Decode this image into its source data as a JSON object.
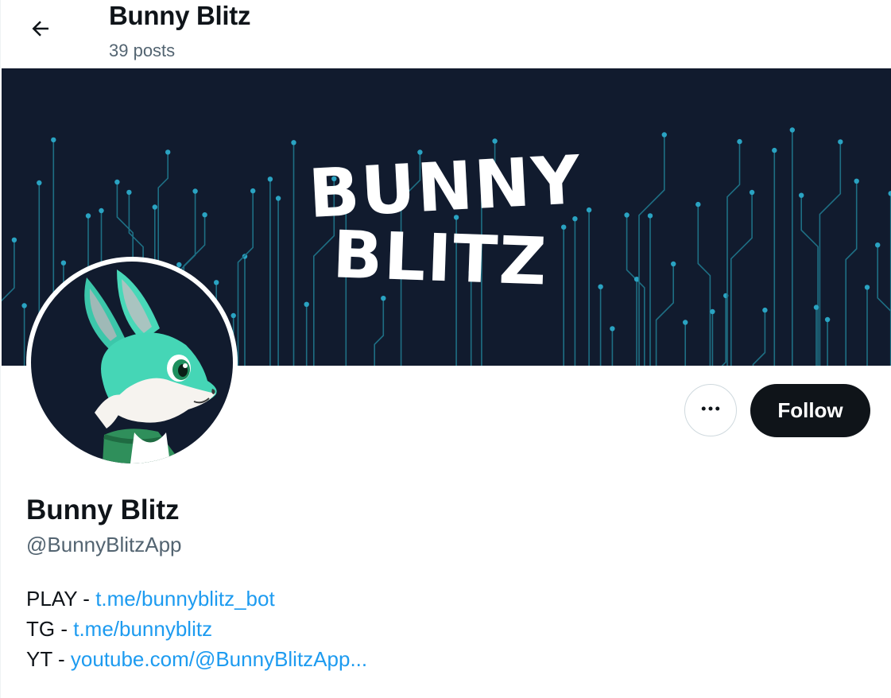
{
  "header": {
    "title": "Bunny Blitz",
    "post_count": "39 posts",
    "back_icon": "arrow-left-icon"
  },
  "banner": {
    "line1": "BUNNY",
    "line2": "BLITZ",
    "colors": {
      "background": "#111b2e",
      "circuit": "#1e6f84",
      "node": "#2aa3c2"
    }
  },
  "profile": {
    "display_name": "Bunny Blitz",
    "handle": "@BunnyBlitzApp",
    "avatar_icon": "bunny-avatar-icon"
  },
  "actions": {
    "more_icon": "more-horizontal-icon",
    "follow_label": "Follow"
  },
  "bio": [
    {
      "prefix": "PLAY - ",
      "link": "t.me/bunnyblitz_bot"
    },
    {
      "prefix": "TG - ",
      "link": "t.me/bunnyblitz"
    },
    {
      "prefix": "YT - ",
      "link": "youtube.com/@BunnyBlitzApp..."
    }
  ],
  "colors": {
    "link": "#1d9bf0",
    "secondary_text": "#536471",
    "button": "#0f1419"
  }
}
